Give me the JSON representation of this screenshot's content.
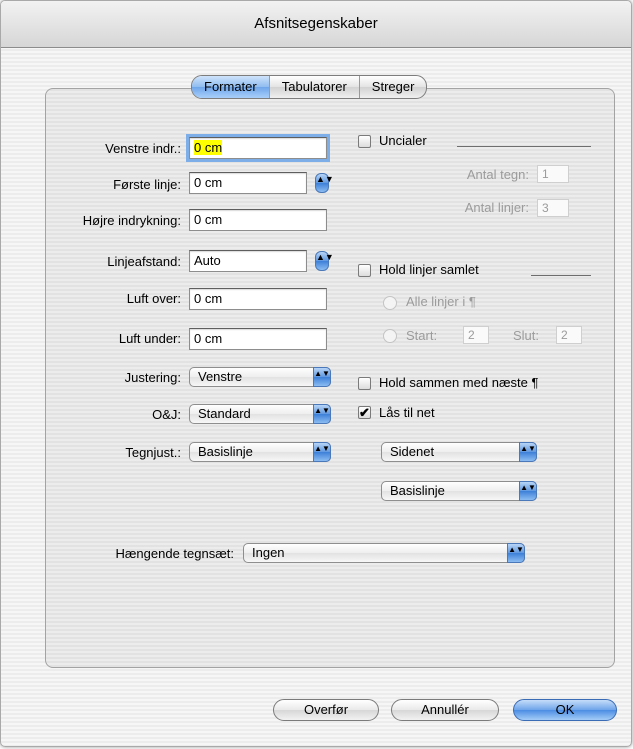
{
  "window": {
    "title": "Afsnitsegenskaber"
  },
  "tabs": [
    {
      "label": "Formater",
      "active": true
    },
    {
      "label": "Tabulatorer",
      "active": false
    },
    {
      "label": "Streger",
      "active": false
    }
  ],
  "left": {
    "venstre_indr": {
      "label": "Venstre indr.:",
      "value": "0 cm"
    },
    "forste_linje": {
      "label": "Første linje:",
      "value": "0 cm"
    },
    "hojre_indrykning": {
      "label": "Højre indrykning:",
      "value": "0 cm"
    },
    "linjeafstand": {
      "label": "Linjeafstand:",
      "value": "Auto"
    },
    "luft_over": {
      "label": "Luft over:",
      "value": "0 cm"
    },
    "luft_under": {
      "label": "Luft under:",
      "value": "0 cm"
    },
    "justering": {
      "label": "Justering:",
      "value": "Venstre"
    },
    "oj": {
      "label": "O&J:",
      "value": "Standard"
    },
    "tegnjust": {
      "label": "Tegnjust.:",
      "value": "Basislinje"
    }
  },
  "right": {
    "uncialer": {
      "label": "Uncialer",
      "checked": false
    },
    "antal_tegn": {
      "label": "Antal tegn:",
      "value": "1"
    },
    "antal_linjer": {
      "label": "Antal linjer:",
      "value": "3"
    },
    "hold_linjer": {
      "label": "Hold linjer samlet",
      "checked": false
    },
    "alle_linjer": {
      "label": "Alle linjer i ¶"
    },
    "start": {
      "label": "Start:",
      "value": "2"
    },
    "slut": {
      "label": "Slut:",
      "value": "2"
    },
    "hold_sammen": {
      "label": "Hold sammen med næste ¶",
      "checked": false
    },
    "laas_til_net": {
      "label": "Lås til net",
      "checked": true
    },
    "sidenet": {
      "value": "Sidenet"
    },
    "basislinje": {
      "value": "Basislinje"
    }
  },
  "haengende": {
    "label": "Hængende tegnsæt:",
    "value": "Ingen"
  },
  "buttons": {
    "overfor": "Overfør",
    "annuller": "Annullér",
    "ok": "OK"
  },
  "glyphs": {
    "check": "✔",
    "updown": "▲▼"
  },
  "colors": {
    "accent": "#6fa6ea",
    "highlight": "#ffff00"
  }
}
